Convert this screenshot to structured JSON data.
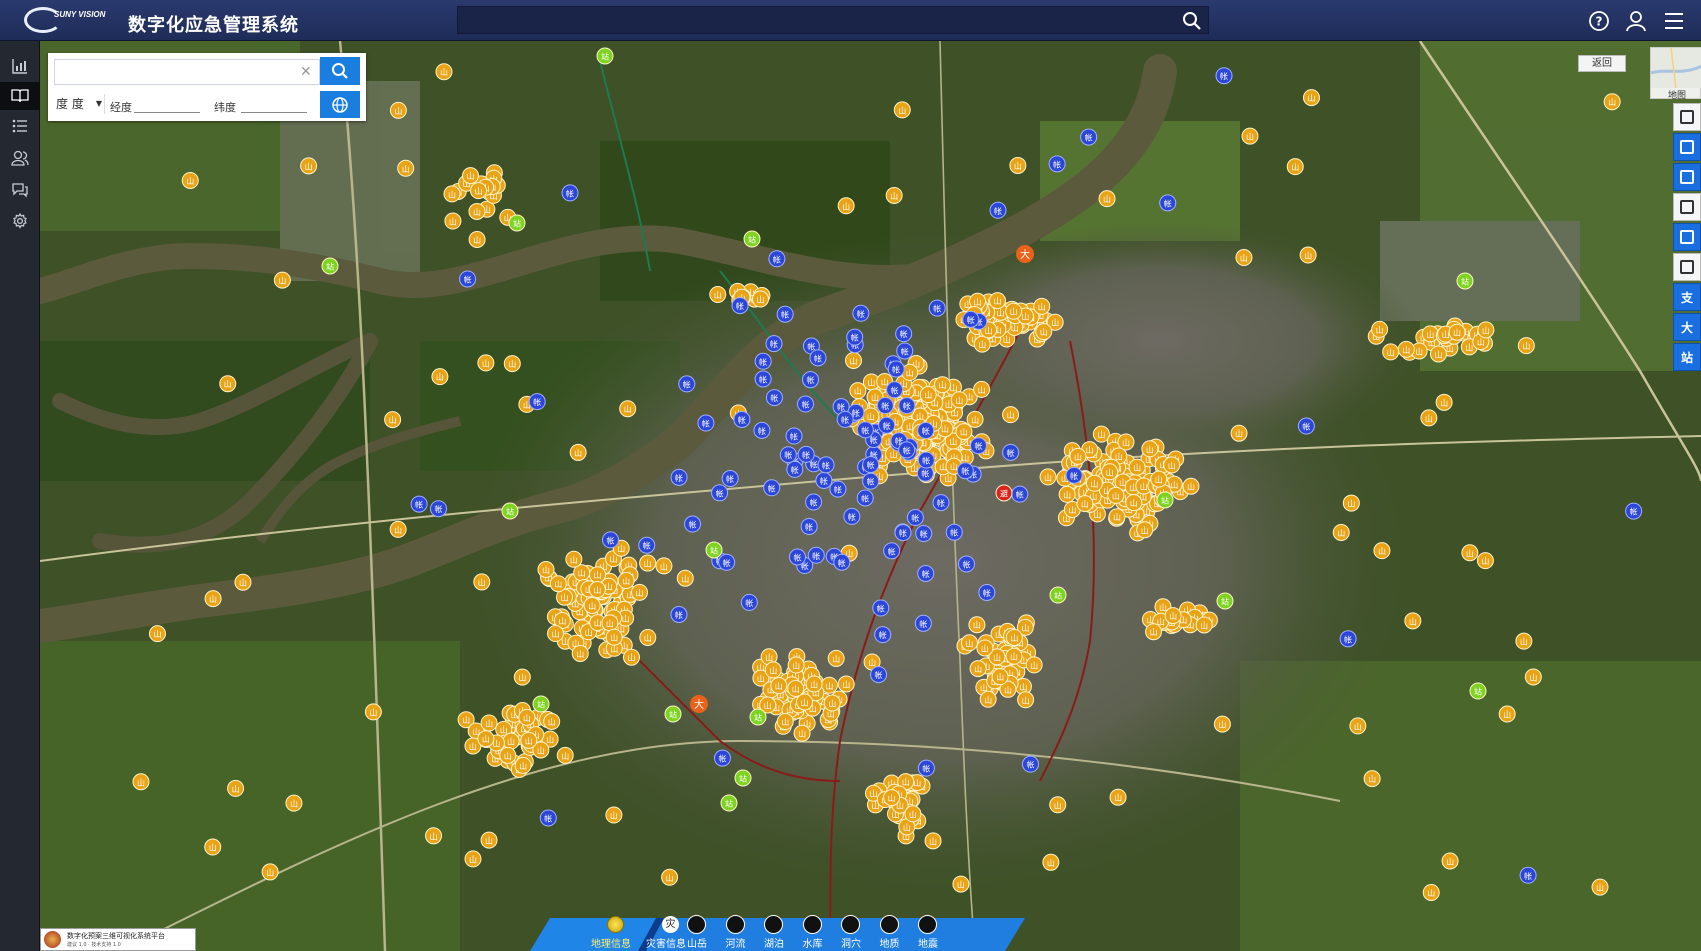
{
  "app": {
    "logo_text": "SUNY VISION",
    "logo_sub": "",
    "title": "数字化应急管理系统"
  },
  "topbar": {
    "search_value": "",
    "icons": [
      "search-icon",
      "help-icon",
      "user-icon",
      "menu-icon"
    ]
  },
  "sidebar": {
    "items": [
      {
        "name": "statistics",
        "icon": "bar-chart-icon",
        "active": false
      },
      {
        "name": "map",
        "icon": "book-icon",
        "active": true
      },
      {
        "name": "list",
        "icon": "list-icon",
        "active": false
      },
      {
        "name": "users",
        "icon": "users-icon",
        "active": false
      },
      {
        "name": "messages",
        "icon": "chat-icon",
        "active": false
      },
      {
        "name": "settings",
        "icon": "gear-icon",
        "active": false
      }
    ]
  },
  "search_panel": {
    "input_value": "",
    "unit_selected": "度 度",
    "lng_label": "经度",
    "lat_label": "纬度",
    "lng_value": "",
    "lat_value": ""
  },
  "map_controls": {
    "back_label": "返回",
    "minimap_label": "地图"
  },
  "right_toolbar": [
    {
      "name": "layer-panel",
      "icon": "panel-icon",
      "label": "",
      "white": true
    },
    {
      "name": "building",
      "icon": "building-icon",
      "label": "",
      "white": false
    },
    {
      "name": "office",
      "icon": "office-icon",
      "label": "",
      "white": false
    },
    {
      "name": "shelter",
      "icon": "house-icon",
      "label": "",
      "white": true
    },
    {
      "name": "crowd",
      "icon": "crowd-icon",
      "label": "",
      "white": false
    },
    {
      "name": "route",
      "icon": "route-icon",
      "label": "",
      "white": true
    },
    {
      "name": "branch",
      "icon": "",
      "label": "支",
      "white": false
    },
    {
      "name": "large",
      "icon": "",
      "label": "大",
      "white": false
    },
    {
      "name": "station",
      "icon": "",
      "label": "站",
      "white": false
    }
  ],
  "bottom_bar": {
    "main_tabs": [
      {
        "label": "地理信息",
        "icon": "globe-icon"
      },
      {
        "label": "灾害信息",
        "icon": "disaster-icon",
        "glyph": "灾"
      }
    ],
    "categories": [
      {
        "label": "山岳",
        "icon": "mountain-icon"
      },
      {
        "label": "河流",
        "icon": "river-icon"
      },
      {
        "label": "湖泊",
        "icon": "lake-icon"
      },
      {
        "label": "水库",
        "icon": "reservoir-icon"
      },
      {
        "label": "洞穴",
        "icon": "cave-icon"
      },
      {
        "label": "地质",
        "icon": "geology-icon"
      },
      {
        "label": "地震",
        "icon": "earthquake-icon"
      }
    ]
  },
  "banner": {
    "title": "数字化预案三维可视化系统平台",
    "subtitle": "建议 1.0 · 技术支持 1.0"
  },
  "marker_glyphs": {
    "orange": "山",
    "blue": "帐",
    "green": "站",
    "red": "避",
    "large": "大"
  },
  "colors": {
    "topbar": "#24356a",
    "sidebar": "#232831",
    "accent_blue": "#1a7de0",
    "marker_orange": "#e8a317",
    "marker_blue": "#2b46d8",
    "marker_green": "#7ed321",
    "marker_red": "#d9261c",
    "river": "#5b5a3c"
  }
}
